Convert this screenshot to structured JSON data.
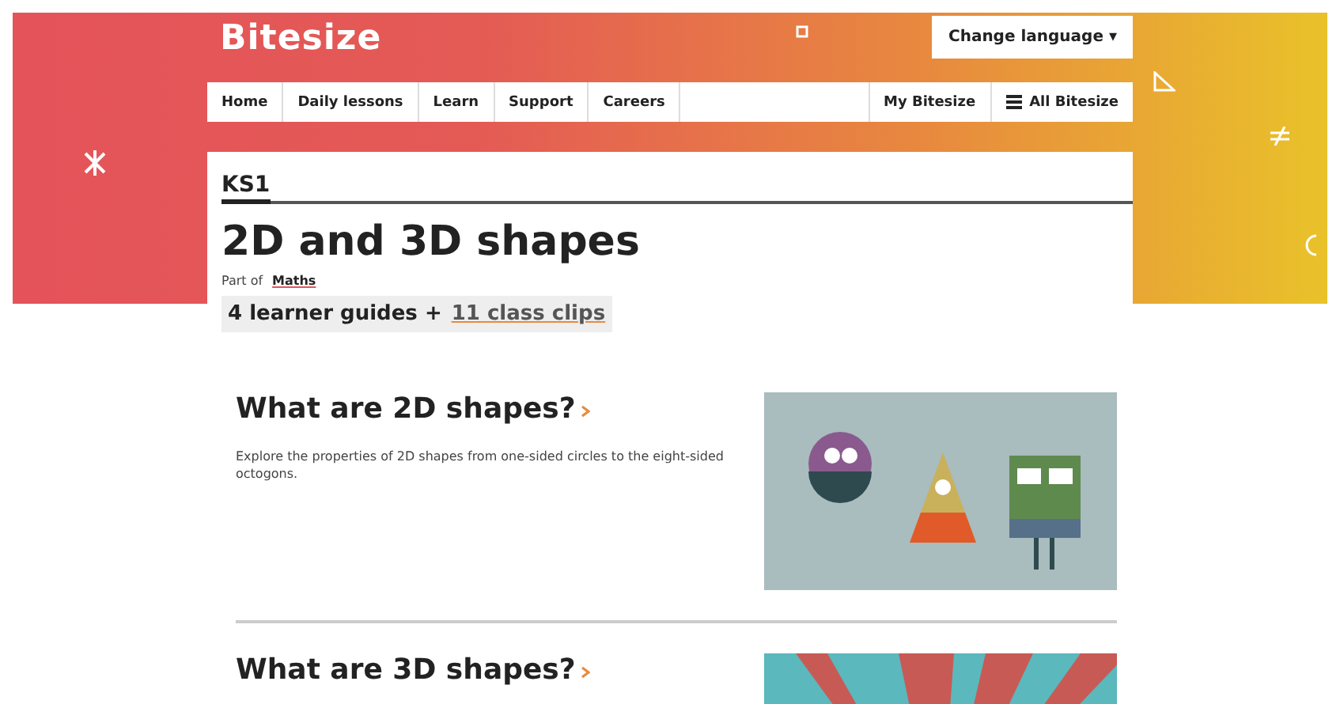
{
  "header": {
    "logo": "Bitesize",
    "language_button": "Change language ▾"
  },
  "nav": {
    "items": [
      "Home",
      "Daily lessons",
      "Learn",
      "Support",
      "Careers"
    ],
    "right_items": [
      "My Bitesize",
      "All Bitesize"
    ]
  },
  "topic": {
    "level": "KS1",
    "title": "2D and 3D shapes",
    "part_of_label": "Part of",
    "subject": "Maths",
    "guides_count": "4 learner guides +",
    "clips_link": "11 class clips"
  },
  "guides": [
    {
      "title": "What are 2D shapes?",
      "description": "Explore the properties of 2D shapes from one-sided circles to the eight-sided octogons.",
      "kind": "characters"
    },
    {
      "title": "What are 3D shapes?",
      "kind": "sunburst"
    }
  ]
}
